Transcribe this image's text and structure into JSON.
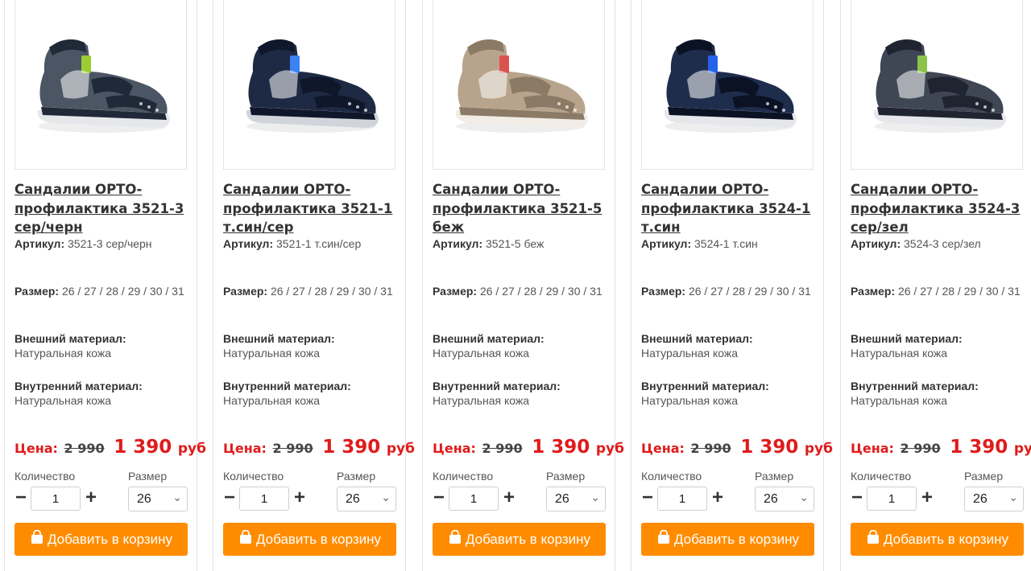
{
  "labels": {
    "article": "Артикул:",
    "size": "Размер:",
    "outer": "Внешний материал:",
    "inner": "Внутренний материал:",
    "price": "Цена:",
    "quantity": "Количество",
    "size_select": "Размер",
    "add_to_cart": "Добавить в корзину",
    "currency": "руб"
  },
  "colors": {
    "accent": "#ff8c00",
    "price_red": "#e01b1b"
  },
  "products": [
    {
      "title": "Сандалии ОРТО-профилактика 3521-3 сер/черн",
      "article": "3521-3 сер/черн",
      "sizes": "26 / 27 / 28 / 29 / 30 / 31",
      "outer_material": "Натуральная кожа",
      "inner_material": "Натуральная кожа",
      "old_price": "2 990",
      "new_price": "1 390",
      "quantity": "1",
      "selected_size": "26",
      "shoe": {
        "upper": "#4b5563",
        "dark": "#1f2937",
        "accent": "#9acd32",
        "sole": "#e5e7eb"
      }
    },
    {
      "title": "Сандалии ОРТО-профилактика 3521-1 т.син/сер",
      "article": "3521-1 т.син/сер",
      "sizes": "26 / 27 / 28 / 29 / 30 / 31",
      "outer_material": "Натуральная кожа",
      "inner_material": "Натуральная кожа",
      "old_price": "2 990",
      "new_price": "1 390",
      "quantity": "1",
      "selected_size": "26",
      "shoe": {
        "upper": "#1e2a44",
        "dark": "#0f172a",
        "accent": "#3b82f6",
        "sole": "#d1d5db"
      }
    },
    {
      "title": "Сандалии ОРТО-профилактика 3521-5 беж",
      "article": "3521-5 беж",
      "sizes": "26 / 27 / 28 / 29 / 30 / 31",
      "outer_material": "Натуральная кожа",
      "inner_material": "Натуральная кожа",
      "old_price": "2 990",
      "new_price": "1 390",
      "quantity": "1",
      "selected_size": "26",
      "shoe": {
        "upper": "#b8a48c",
        "dark": "#8b7a66",
        "accent": "#d9534f",
        "sole": "#f1ede6"
      }
    },
    {
      "title": "Сандалии ОРТО-профилактика 3524-1 т.син",
      "article": "3524-1 т.син",
      "sizes": "26 / 27 / 28 / 29 / 30 / 31",
      "outer_material": "Натуральная кожа",
      "inner_material": "Натуральная кожа",
      "old_price": "2 990",
      "new_price": "1 390",
      "quantity": "1",
      "selected_size": "26",
      "shoe": {
        "upper": "#1f2d4d",
        "dark": "#0b1224",
        "accent": "#2563eb",
        "sole": "#e5e7eb"
      }
    },
    {
      "title": "Сандалии ОРТО-профилактика 3524-3 сер/зел",
      "article": "3524-3 сер/зел",
      "sizes": "26 / 27 / 28 / 29 / 30 / 31",
      "outer_material": "Натуральная кожа",
      "inner_material": "Натуральная кожа",
      "old_price": "2 990",
      "new_price": "1 390",
      "quantity": "1",
      "selected_size": "26",
      "shoe": {
        "upper": "#3f4654",
        "dark": "#1f2430",
        "accent": "#8bc34a",
        "sole": "#e5e7eb"
      }
    }
  ]
}
